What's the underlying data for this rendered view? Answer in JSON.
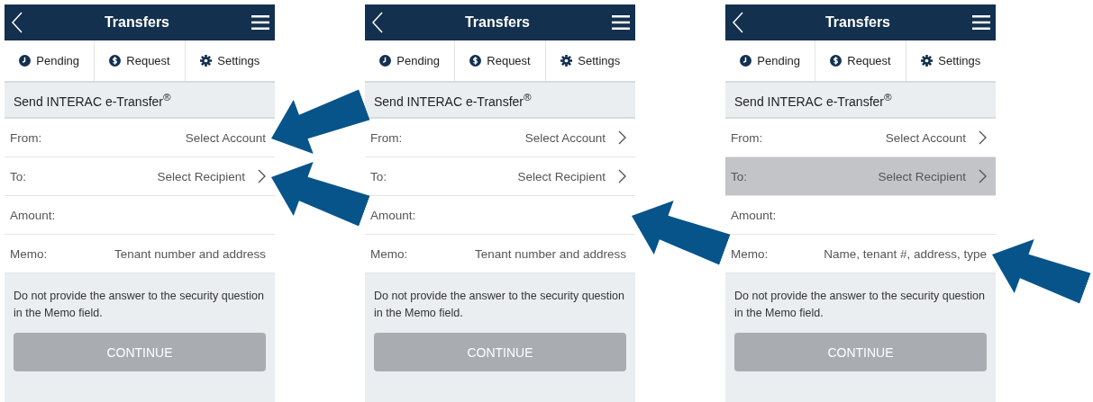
{
  "screens": [
    {
      "title": "Transfers",
      "tabs": [
        {
          "label": "Pending",
          "kind": "clock"
        },
        {
          "label": "Request",
          "kind": "dollar"
        },
        {
          "label": "Settings",
          "kind": "gear"
        }
      ],
      "section_title": "Send INTERAC e-Transfer$^{®}$",
      "rows": [
        {
          "label": "From:",
          "value": "Select Account",
          "chevron": false,
          "highlighted": false,
          "callout": true,
          "callout_rising": false
        },
        {
          "label": "To:",
          "value": "Select Recipient",
          "chevron": true,
          "highlighted": false,
          "callout": true,
          "callout_rising": true
        },
        {
          "label": "Amount:",
          "chevron": false,
          "highlighted": false,
          "callout": false
        },
        {
          "label": "Memo:",
          "value": "Tenant number and address",
          "chevron": false,
          "highlighted": false,
          "callout": false
        }
      ],
      "note": "Do not provide the answer to the security question in the Memo field.",
      "button": {
        "label": "CONTINUE",
        "disabled": true
      }
    },
    {
      "title": "Transfers",
      "tabs": [
        {
          "label": "Pending",
          "kind": "clock"
        },
        {
          "label": "Request",
          "kind": "dollar"
        },
        {
          "label": "Settings",
          "kind": "gear"
        }
      ],
      "section_title": "Send INTERAC e-Transfer$^{®}$",
      "rows": [
        {
          "label": "From:",
          "value": "Select Account",
          "chevron": true,
          "highlighted": false,
          "callout": false
        },
        {
          "label": "To:",
          "value": "Select Recipient",
          "chevron": true,
          "highlighted": false,
          "callout": false
        },
        {
          "label": "Amount:",
          "chevron": false,
          "highlighted": false,
          "callout": true,
          "callout_rising": true
        },
        {
          "label": "Memo:",
          "value": "Tenant number and address",
          "chevron": false,
          "highlighted": false,
          "callout": false
        }
      ],
      "note": "Do not provide the answer to the security question in the Memo field.",
      "button": {
        "label": "CONTINUE",
        "disabled": true
      }
    },
    {
      "title": "Transfers",
      "tabs": [
        {
          "label": "Pending",
          "kind": "clock"
        },
        {
          "label": "Request",
          "kind": "dollar"
        },
        {
          "label": "Settings",
          "kind": "gear"
        }
      ],
      "section_title": "Send INTERAC e-Transfer$^{®}$",
      "rows": [
        {
          "label": "From:",
          "value": "Select Account",
          "chevron": true,
          "highlighted": false,
          "callout": false
        },
        {
          "label": "To:",
          "value": "Select Recipient",
          "chevron": true,
          "highlighted": true,
          "callout": false
        },
        {
          "label": "Amount:",
          "chevron": false,
          "highlighted": false,
          "callout": false
        },
        {
          "label": "Memo:",
          "value": "Name, tenant #, address, type",
          "chevron": false,
          "highlighted": false,
          "callout": true,
          "callout_rising": true
        }
      ],
      "note": "Do not provide the answer to the security question in the Memo field.",
      "button": {
        "label": "CONTINUE",
        "disabled": true
      }
    }
  ]
}
